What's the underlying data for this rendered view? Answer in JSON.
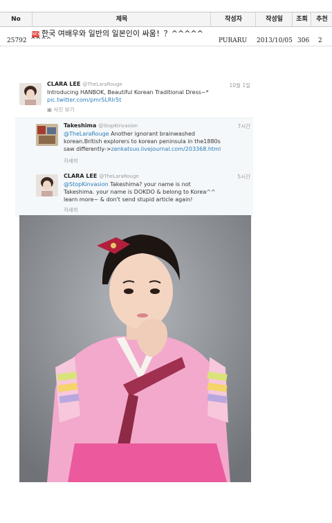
{
  "board": {
    "headers": {
      "no": "No",
      "title": "제목",
      "author": "작성자",
      "date": "작성일",
      "views": "조회",
      "likes": "추천"
    },
    "post": {
      "no": "25792",
      "badge": "NEW",
      "title_line1": "한국 여배우와 일반의 일본인이 싸움！？^^^^^",
      "title_line2": "^^^^",
      "author": "PURARU",
      "date": "2013/10/05",
      "views": "306",
      "likes": "2"
    }
  },
  "tweets": [
    {
      "name": "CLARA LEE",
      "handle": "@TheLaraRouge",
      "time": "10월 1일",
      "text": "Introducing HANBOK, Beautiful Korean Traditional Dress~*",
      "link": "pic.twitter.com/pmrSLRIr5t",
      "action": "사진 보기"
    },
    {
      "name": "Takeshima",
      "handle": "@StopKinvasion",
      "time": "7시간",
      "mention": "@TheLaraRouge",
      "text1": " Another ignorant brainwashed",
      "text2": "korean.British explorers to korean peninsula in the1880s",
      "text3": "saw differently->",
      "link": "zenkatsuo.livejournal.com/203368.html",
      "action": "자세히"
    },
    {
      "name": "CLARA LEE",
      "handle": "@TheLaraRouge",
      "time": "5시간",
      "mention": "@StopKinvasion",
      "text1": " Takeshima? your name is not",
      "text2": "Takeshima. your name is DOKDO & belong to Korea^^",
      "text3": "learn more~ & don't send stupid article again!",
      "action": "자세히"
    }
  ],
  "colors": {
    "link": "#2b7bb9",
    "header_bg": "#f4f4f4",
    "new_badge": "#e2453f",
    "hanbok_pink": "#f2a9cc"
  }
}
